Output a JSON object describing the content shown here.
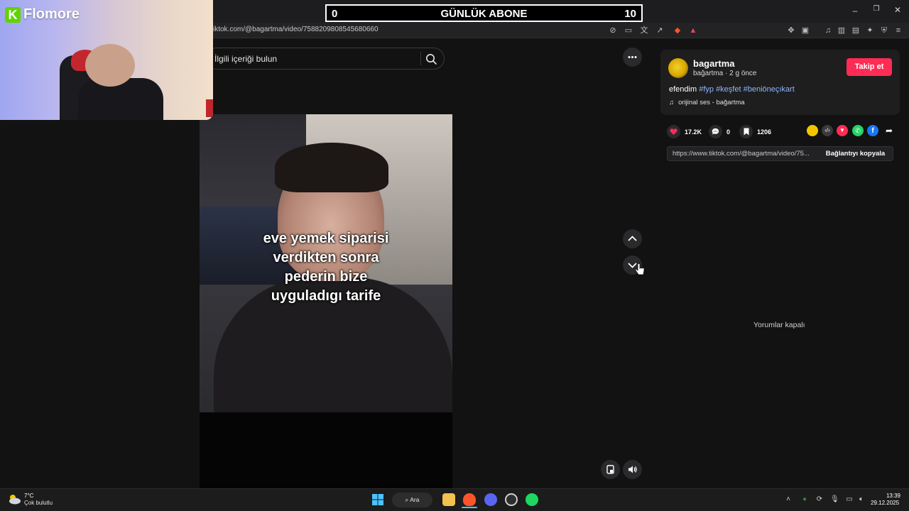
{
  "overlay": {
    "counter_left": "0",
    "counter_title": "GÜNLÜK ABONE",
    "counter_right": "10",
    "brand_letter": "K",
    "brand_name": "Flomore"
  },
  "browser": {
    "url": "iktok.com/@bagartma/video/7588209808545680660"
  },
  "search": {
    "placeholder": "İlgili içeriği bulun"
  },
  "video": {
    "caption_lines": [
      "eve yemek siparisi",
      "verdikten sonra",
      "pederin bize",
      "uyguladıgı tarife"
    ]
  },
  "post": {
    "author": "bagartma",
    "meta": "bağartma · 2 g önce",
    "follow_label": "Takip et",
    "description_text": "efendim ",
    "hashtags": [
      "#fyp",
      "#keşfet",
      "#beniöneçıkart"
    ],
    "music": "orijinal ses - bağartma",
    "likes": "17.2K",
    "comments": "0",
    "saves": "1206",
    "link_url": "https://www.tiktok.com/@bagartma/video/75...",
    "copy_link_label": "Bağlantıyı kopyala",
    "comments_off": "Yorumlar kapalı"
  },
  "share_colors": {
    "coin": "#f5c400",
    "embed": "#3a3a3c",
    "tiktok": "#fe2c55",
    "whatsapp": "#25d366",
    "facebook": "#1877f2"
  },
  "taskbar": {
    "temperature": "7°C",
    "condition": "Çok bulutlu",
    "search_label": "Ara",
    "time": "13:39",
    "date": "29.12.2025"
  }
}
